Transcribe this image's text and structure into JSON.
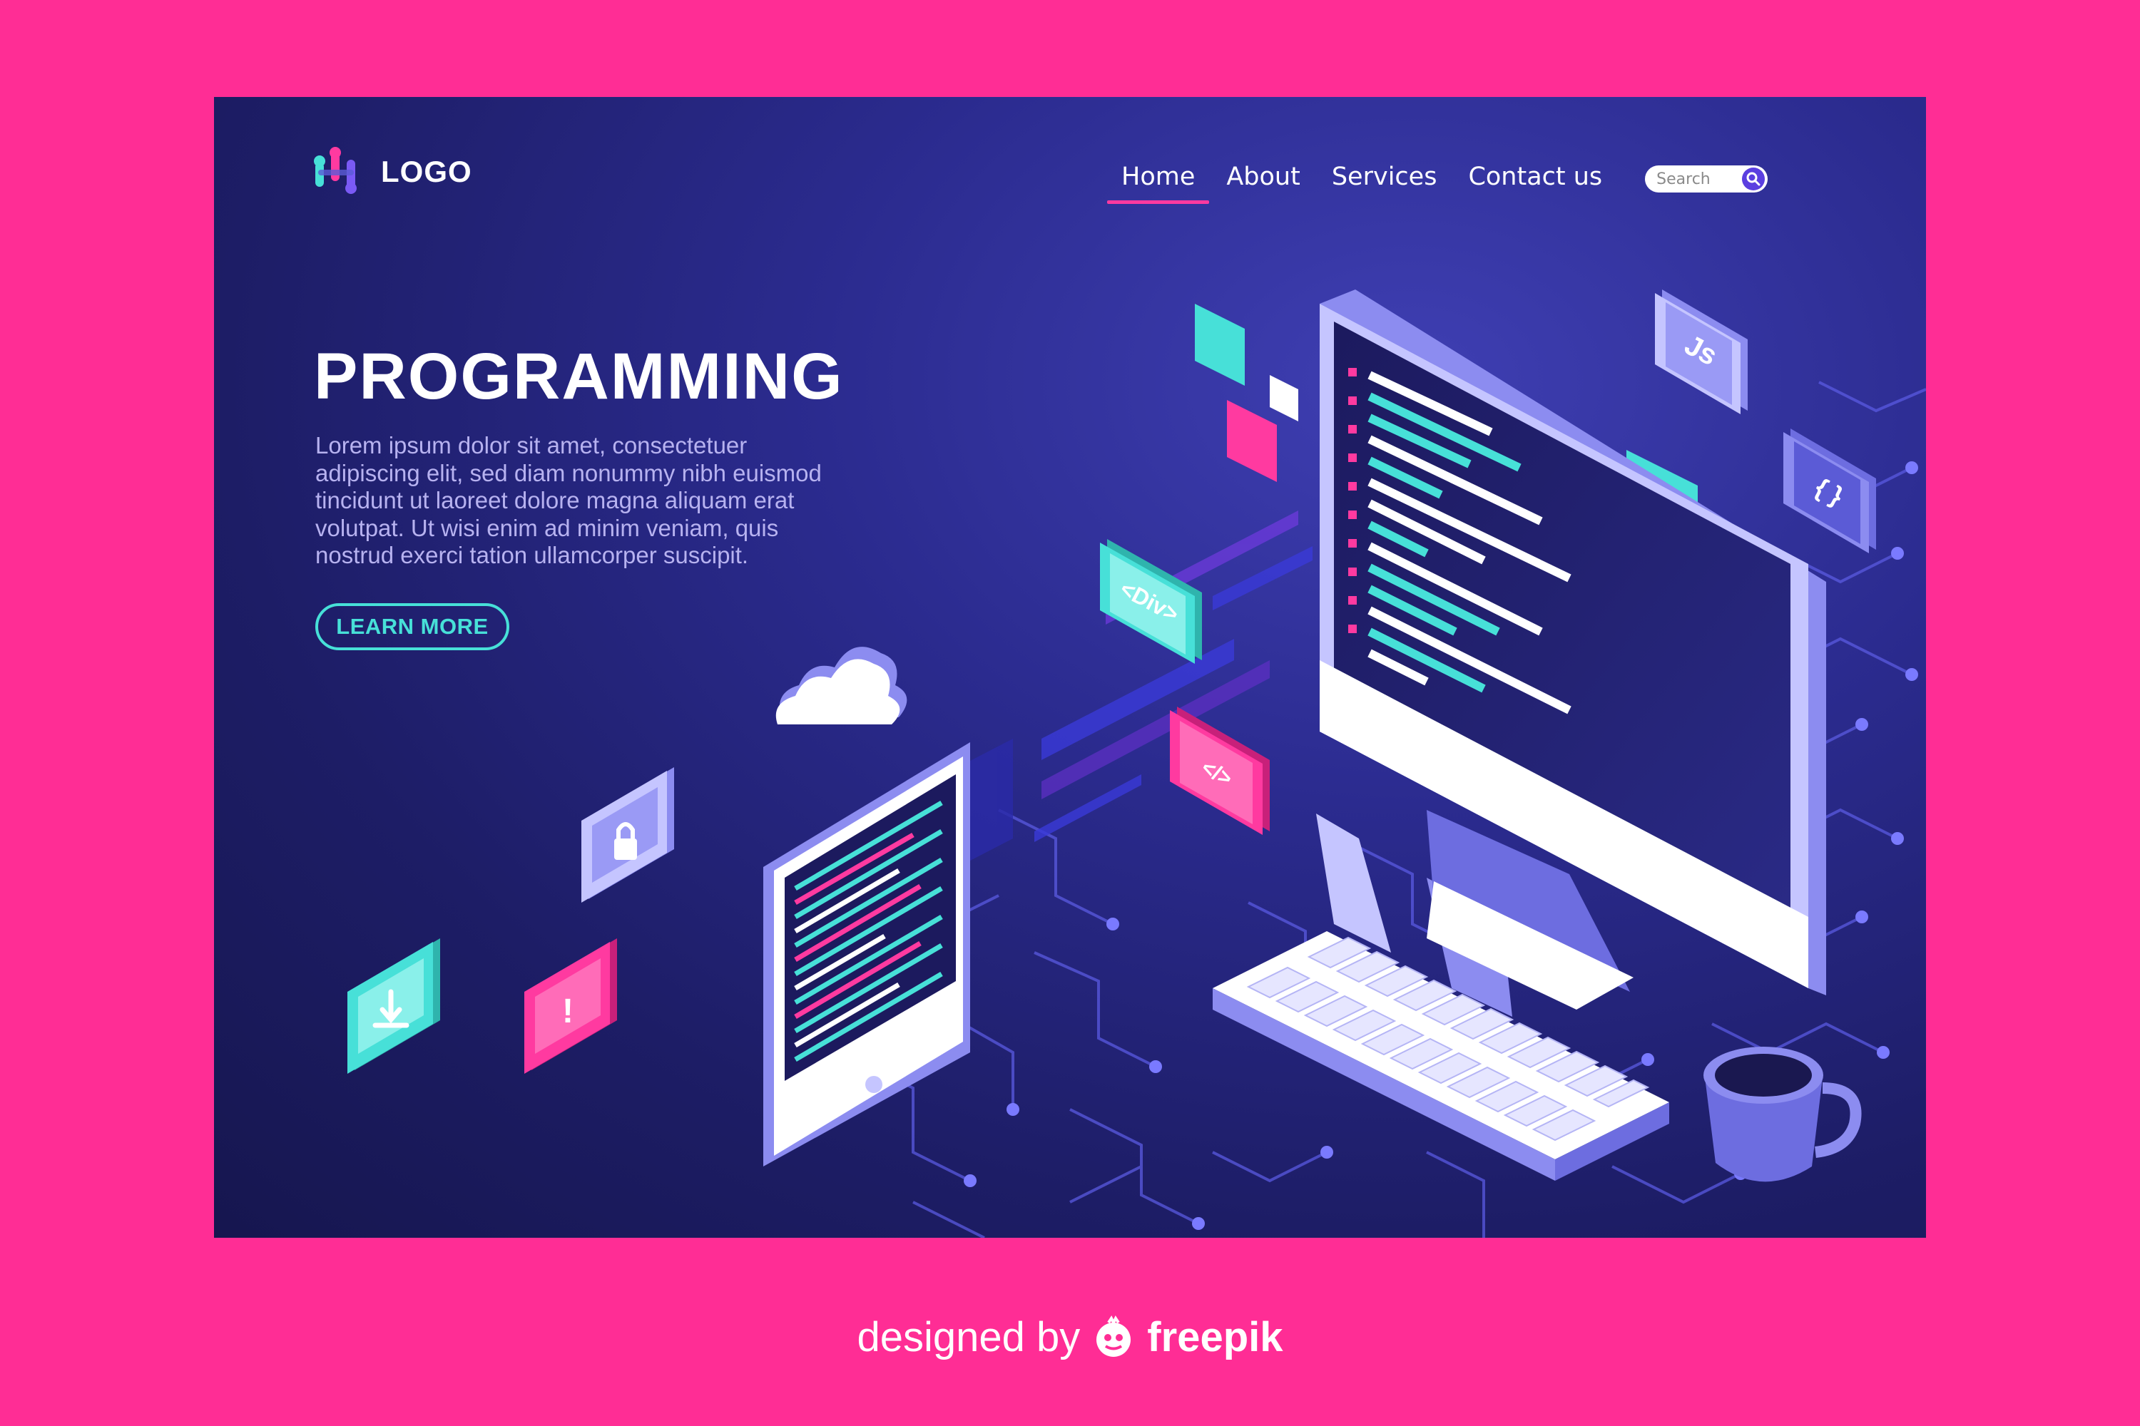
{
  "brand": {
    "logo_text": "LOGO",
    "logo_icon": "molecule-logo-icon"
  },
  "nav": {
    "items": [
      {
        "label": "Home",
        "active": true
      },
      {
        "label": "About",
        "active": false
      },
      {
        "label": "Services",
        "active": false
      },
      {
        "label": "Contact us",
        "active": false
      }
    ],
    "search": {
      "placeholder": "Search",
      "icon": "search-icon"
    }
  },
  "hero": {
    "title": "PROGRAMMING",
    "body": "Lorem ipsum dolor sit amet, consectetuer adipiscing elit, sed diam nonummy nibh euismod tincidunt ut laoreet dolore magna aliquam erat volutpat. Ut wisi enim ad minim veniam, quis nostrud exerci tation ullamcorper suscipit.",
    "cta_label": "LEARN MORE"
  },
  "illustration": {
    "tile_js": "Js",
    "tile_braces": "{ }",
    "tile_div": "<Div>",
    "tile_code": "</>",
    "tile_alert": "!",
    "icons": [
      "lock-icon",
      "download-icon",
      "cloud-icon",
      "monitor-icon",
      "keyboard-icon",
      "tablet-icon",
      "mug-icon"
    ]
  },
  "credit": {
    "prefix": "designed by",
    "brand": "freepik"
  },
  "colors": {
    "page_bg": "#ff2d95",
    "card_bg": "#1d1d66",
    "accent_cyan": "#47e0d8",
    "accent_pink": "#ff3aa0",
    "accent_violet": "#8c8cf0"
  }
}
